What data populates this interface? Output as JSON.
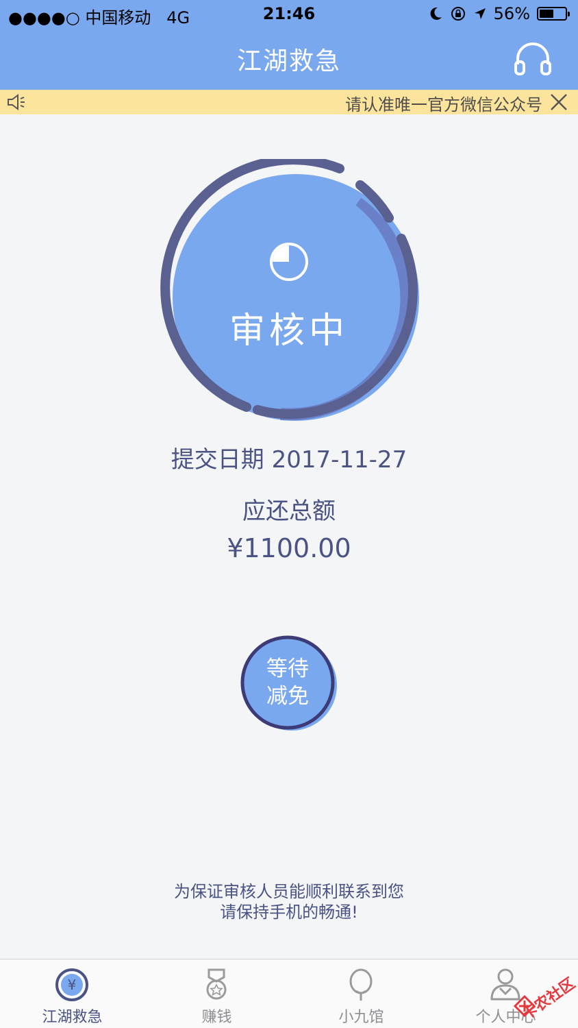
{
  "status_bar": {
    "carrier": "●●●●○ 中国移动",
    "network": "4G",
    "time": "21:46",
    "battery": "56%",
    "battery_level": 0.56
  },
  "nav": {
    "title": "江湖救急",
    "service_icon": "headset-icon"
  },
  "notice": {
    "text": "请认准唯一官方微信公众号",
    "speaker_icon": "speaker-icon",
    "close_icon": "close-icon"
  },
  "review": {
    "status_label": "审核中",
    "icon": "pie-clock-icon",
    "submit_date_line": "提交日期 2017-11-27",
    "total_label": "应还总额",
    "total_amount": "¥1100.00"
  },
  "wait_button": {
    "line1": "等待",
    "line2": "减免"
  },
  "hint": {
    "line1": "为保证审核人员能顺利联系到您",
    "line2": "请保持手机的畅通!"
  },
  "tabs": [
    {
      "label": "江湖救急",
      "icon": "yuan-coin-icon",
      "active": true
    },
    {
      "label": "赚钱",
      "icon": "medal-icon",
      "active": false
    },
    {
      "label": "小九馆",
      "icon": "balloon-icon",
      "active": false
    },
    {
      "label": "个人中心",
      "icon": "user-icon",
      "active": false
    }
  ],
  "watermark": {
    "text": "卡农社区"
  },
  "colors": {
    "primary": "#79a8ee",
    "dark_ring": "#5a6090",
    "notice_bg": "#fde49c",
    "text": "#4a5383",
    "tab_inactive": "#8e8e93",
    "watermark": "#e5393e"
  }
}
